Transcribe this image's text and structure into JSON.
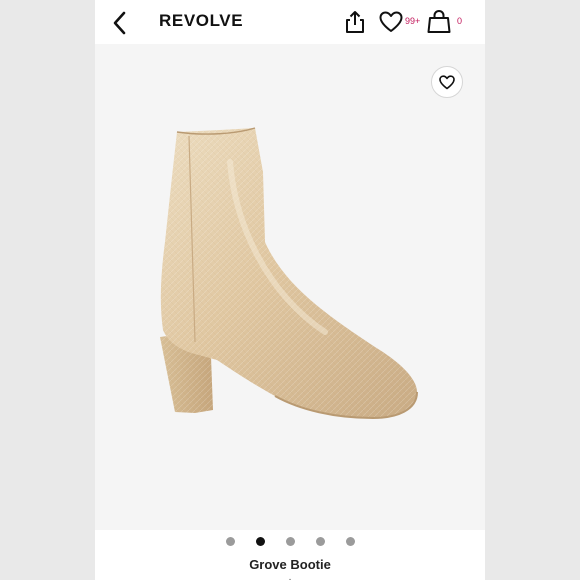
{
  "header": {
    "brand": "REVOLVE",
    "wishlist_count": "99+",
    "bag_count": "0"
  },
  "icons": {
    "back": "chevron-left-icon",
    "share": "share-icon",
    "wishlist": "heart-icon",
    "bag": "shopping-bag-icon",
    "favorite": "heart-icon"
  },
  "carousel": {
    "count": 5,
    "active_index": 1
  },
  "product": {
    "name": "Grove Bootie",
    "image_desc": "metallic-gold-ankle-boot"
  },
  "colors": {
    "badge": "#c2185b",
    "boot": "#e3cba7"
  }
}
